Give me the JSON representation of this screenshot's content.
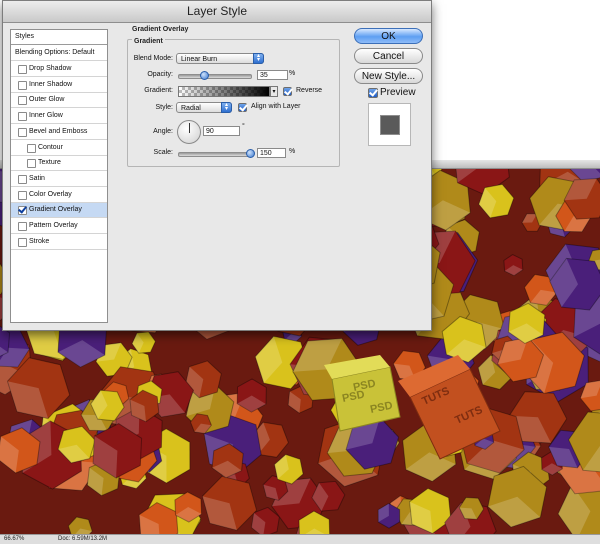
{
  "dialog": {
    "title": "Layer Style"
  },
  "styles_list": {
    "header": "Styles",
    "blending": "Blending Options: Default",
    "items": [
      {
        "label": "Drop Shadow",
        "checked": false,
        "indent": false
      },
      {
        "label": "Inner Shadow",
        "checked": false,
        "indent": false
      },
      {
        "label": "Outer Glow",
        "checked": false,
        "indent": false
      },
      {
        "label": "Inner Glow",
        "checked": false,
        "indent": false
      },
      {
        "label": "Bevel and Emboss",
        "checked": false,
        "indent": false
      },
      {
        "label": "Contour",
        "checked": false,
        "indent": true
      },
      {
        "label": "Texture",
        "checked": false,
        "indent": true
      },
      {
        "label": "Satin",
        "checked": false,
        "indent": false
      },
      {
        "label": "Color Overlay",
        "checked": false,
        "indent": false
      },
      {
        "label": "Gradient Overlay",
        "checked": true,
        "indent": false,
        "selected": true
      },
      {
        "label": "Pattern Overlay",
        "checked": false,
        "indent": false
      },
      {
        "label": "Stroke",
        "checked": false,
        "indent": false
      }
    ]
  },
  "panel": {
    "title": "Gradient Overlay",
    "group": "Gradient",
    "blend_mode_label": "Blend Mode:",
    "blend_mode_value": "Linear Burn",
    "opacity_label": "Opacity:",
    "opacity_value": "35",
    "opacity_unit": "%",
    "opacity_level": 0.35,
    "gradient_label": "Gradient:",
    "reverse_label": "Reverse",
    "reverse_checked": true,
    "style_label": "Style:",
    "style_value": "Radial",
    "align_label": "Align with Layer",
    "align_checked": true,
    "angle_label": "Angle:",
    "angle_value": "90",
    "angle_unit": "°",
    "scale_label": "Scale:",
    "scale_value": "150",
    "scale_unit": "%",
    "scale_level": 1.0
  },
  "buttons": {
    "ok": "OK",
    "cancel": "Cancel",
    "new_style": "New Style...",
    "preview_label": "Preview",
    "preview_checked": true
  },
  "document": {
    "zoom": "66.67%",
    "doc_info": "Doc: 6.59M/13.2M",
    "cube_labels": [
      "PSD",
      "PSD",
      "PSD",
      "TUTS",
      "TUTS"
    ]
  },
  "colors": {
    "accent": "#3b78cf",
    "selected_row": "#c5d9f3",
    "cube_yellow": "#d9c21c",
    "cube_orange": "#d2561a",
    "cube_red": "#8a1616",
    "cube_purple": "#4a1f7a"
  }
}
